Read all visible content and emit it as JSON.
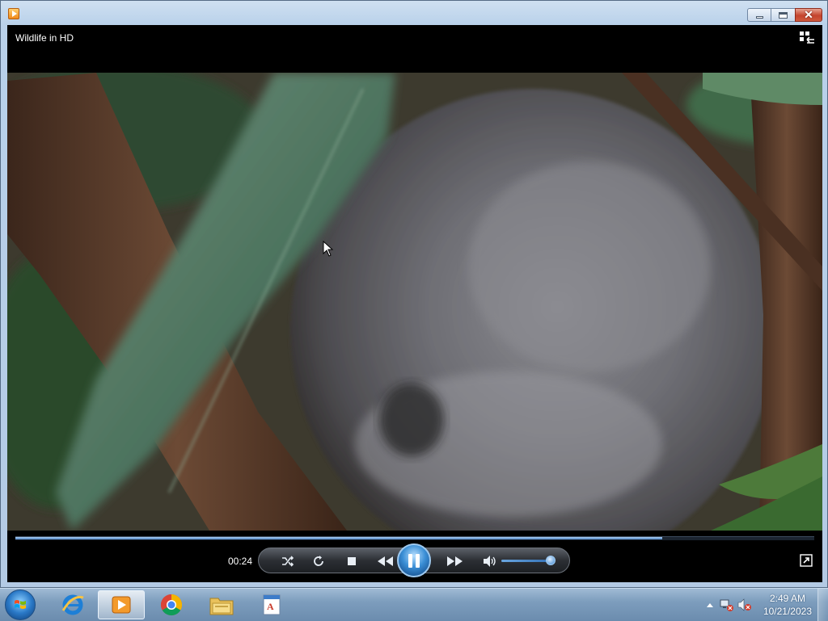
{
  "window": {
    "title": "",
    "icon": "media-player-icon"
  },
  "player": {
    "video_title": "Wildlife in HD",
    "current_time": "00:24",
    "playback_progress_percent": 81,
    "volume_percent": 92,
    "state": "playing",
    "controls": [
      {
        "name": "shuffle-icon"
      },
      {
        "name": "repeat-icon"
      },
      {
        "name": "stop-icon"
      },
      {
        "name": "previous-icon"
      },
      {
        "name": "pause-icon"
      },
      {
        "name": "next-icon"
      },
      {
        "name": "volume-icon"
      }
    ],
    "accent_color": "#3b8fd6"
  },
  "taskbar": {
    "items": [
      {
        "name": "internet-explorer-icon",
        "state": "pinned"
      },
      {
        "name": "windows-media-player-icon",
        "state": "active"
      },
      {
        "name": "chrome-icon",
        "state": "pinned"
      },
      {
        "name": "windows-explorer-icon",
        "state": "pinned"
      },
      {
        "name": "wordpad-icon",
        "state": "pinned"
      }
    ],
    "clock_time": "2:49 AM",
    "clock_date": "10/21/2023"
  }
}
